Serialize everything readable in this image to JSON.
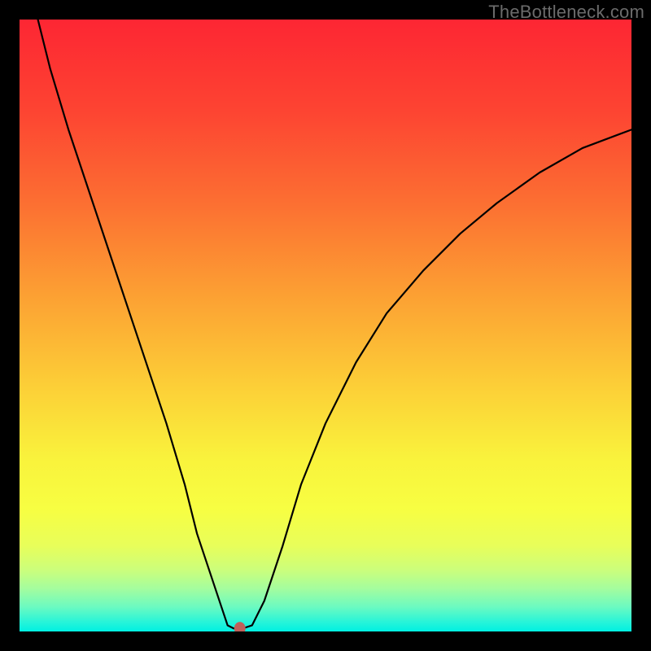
{
  "watermark": "TheBottleneck.com",
  "chart_data": {
    "type": "line",
    "title": "",
    "xlabel": "",
    "ylabel": "",
    "xlim": [
      0,
      100
    ],
    "ylim": [
      0,
      100
    ],
    "grid": false,
    "legend": false,
    "series": [
      {
        "name": "bottleneck-curve",
        "color": "#000000",
        "x": [
          3,
          5,
          8,
          12,
          16,
          20,
          24,
          27,
          29,
          31,
          33,
          34,
          35,
          36.5,
          38,
          40,
          43,
          46,
          50,
          55,
          60,
          66,
          72,
          78,
          85,
          92,
          100
        ],
        "y": [
          100,
          92,
          82,
          70,
          58,
          46,
          34,
          24,
          16,
          10,
          4,
          1,
          0.5,
          0.5,
          1,
          5,
          14,
          24,
          34,
          44,
          52,
          59,
          65,
          70,
          75,
          79,
          82
        ]
      }
    ],
    "marker": {
      "name": "optimal-point",
      "color": "#c0605a",
      "x": 36,
      "y": 0.5,
      "rx": 7,
      "ry": 8
    },
    "background_gradient": {
      "type": "vertical",
      "stops": [
        {
          "offset": 0.0,
          "color": "#fd2633"
        },
        {
          "offset": 0.15,
          "color": "#fd4432"
        },
        {
          "offset": 0.3,
          "color": "#fc6f32"
        },
        {
          "offset": 0.45,
          "color": "#fca033"
        },
        {
          "offset": 0.6,
          "color": "#fccf37"
        },
        {
          "offset": 0.72,
          "color": "#f9f33c"
        },
        {
          "offset": 0.8,
          "color": "#f7fe42"
        },
        {
          "offset": 0.86,
          "color": "#e8fe5a"
        },
        {
          "offset": 0.9,
          "color": "#cbfe7c"
        },
        {
          "offset": 0.93,
          "color": "#a4fd9e"
        },
        {
          "offset": 0.96,
          "color": "#6bfac1"
        },
        {
          "offset": 0.985,
          "color": "#26f4d9"
        },
        {
          "offset": 1.0,
          "color": "#00f0e2"
        }
      ]
    },
    "green_band": {
      "top_fraction": 0.8,
      "bottom_fraction": 1.0
    }
  }
}
